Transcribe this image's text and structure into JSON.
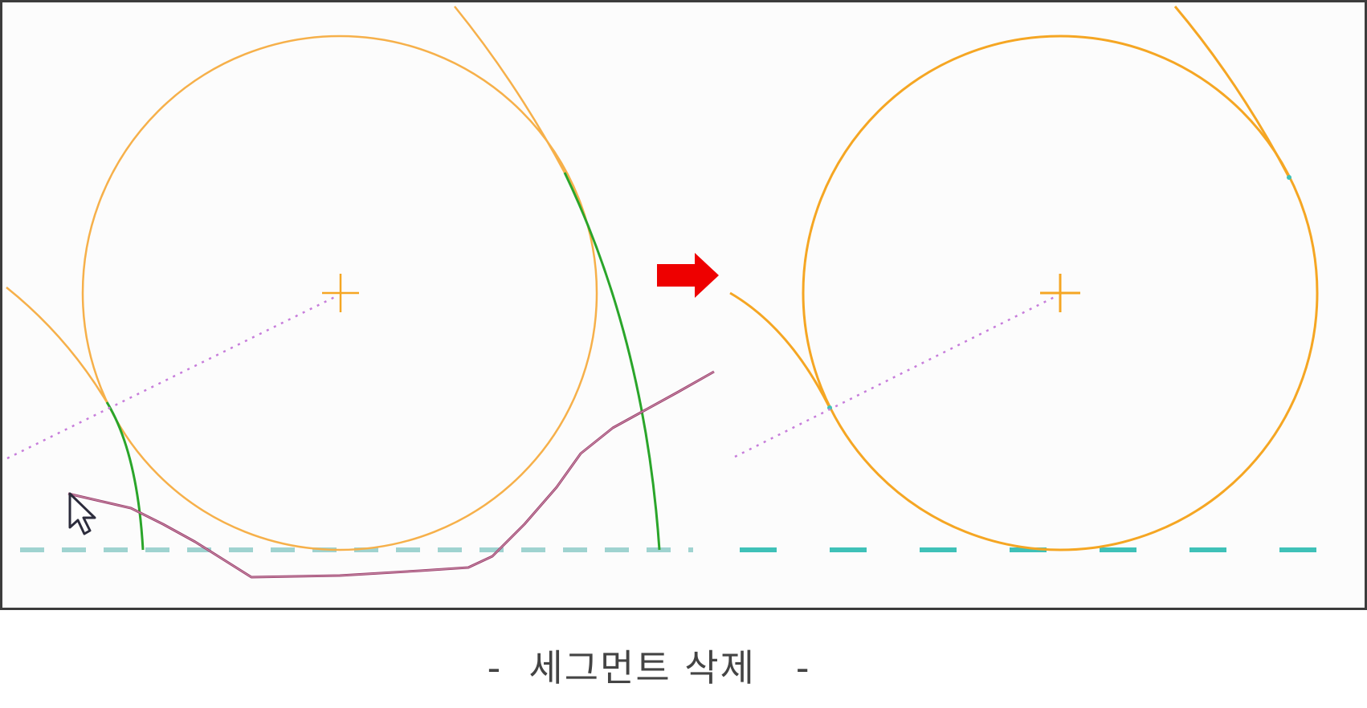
{
  "caption": "-  세그먼트 삭제   -",
  "colors": {
    "circle": "#f5a623",
    "circle_before": "#f6b04a",
    "highlight_segment": "#2aa52a",
    "dotted_line": "#c77ddb",
    "ground_line_before": "#9fd3d0",
    "ground_line_after": "#3fc1b8",
    "trim_stroke": "#9b3a6a",
    "trim_stroke_light": "#c78fa8",
    "arrow": "#ee0000",
    "frame_bg": "#fcfcfc",
    "frame_border": "#3c3c3c",
    "caption": "#444444"
  },
  "icons": {
    "cursor": "mouse-pointer-icon",
    "arrow": "right-arrow-icon",
    "center_mark": "crosshair-icon"
  }
}
